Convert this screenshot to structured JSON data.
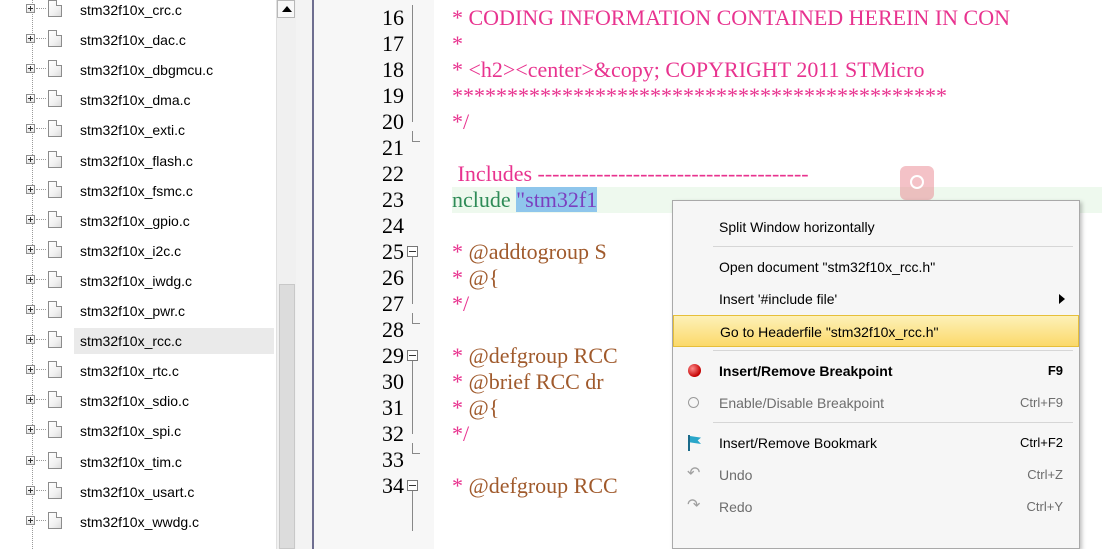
{
  "tree": {
    "selected_index": 11,
    "files": [
      "stm32f10x_crc.c",
      "stm32f10x_dac.c",
      "stm32f10x_dbgmcu.c",
      "stm32f10x_dma.c",
      "stm32f10x_exti.c",
      "stm32f10x_flash.c",
      "stm32f10x_fsmc.c",
      "stm32f10x_gpio.c",
      "stm32f10x_i2c.c",
      "stm32f10x_iwdg.c",
      "stm32f10x_pwr.c",
      "stm32f10x_rcc.c",
      "stm32f10x_rtc.c",
      "stm32f10x_sdio.c",
      "stm32f10x_spi.c",
      "stm32f10x_tim.c",
      "stm32f10x_usart.c",
      "stm32f10x_wwdg.c"
    ]
  },
  "editor": {
    "lines": [
      {
        "num": "16",
        "text": "* CODING INFORMATION CONTAINED HEREIN IN CON",
        "style": "comment"
      },
      {
        "num": "17",
        "text": "*",
        "style": "comment"
      },
      {
        "num": "18",
        "text": "* <h2><center>&copy; COPYRIGHT 2011 STMicro",
        "style": "comment"
      },
      {
        "num": "19",
        "text": "*********************************************",
        "style": "comment"
      },
      {
        "num": "20",
        "text": "*/",
        "style": "comment"
      },
      {
        "num": "21",
        "text": "",
        "style": "plain"
      },
      {
        "num": "22",
        "text": " Includes -------------------------------------",
        "style": "comment"
      },
      {
        "num": "23",
        "text_pre": "nclude ",
        "text_str": "\"stm32f1",
        "style": "include"
      },
      {
        "num": "24",
        "text": "",
        "style": "plain"
      },
      {
        "num": "25",
        "text_a": "* ",
        "text_b": "@addtogroup S",
        "style": "kwcomment",
        "fold": true
      },
      {
        "num": "26",
        "text_a": "* ",
        "text_b": "@{",
        "style": "kwcomment"
      },
      {
        "num": "27",
        "text": "*/",
        "style": "comment"
      },
      {
        "num": "28",
        "text": "",
        "style": "plain"
      },
      {
        "num": "29",
        "text_a": "* ",
        "text_b": "@defgroup RCC",
        "style": "kwcomment",
        "fold": true
      },
      {
        "num": "30",
        "text_a": "* ",
        "text_b": "@brief RCC dr",
        "style": "kwcomment"
      },
      {
        "num": "31",
        "text_a": "* ",
        "text_b": "@{",
        "style": "kwcomment"
      },
      {
        "num": "32",
        "text": "*/",
        "style": "comment"
      },
      {
        "num": "33",
        "text": "",
        "style": "plain"
      },
      {
        "num": "34",
        "text_a": "* ",
        "text_b": "@defgroup RCC",
        "style": "kwcomment",
        "fold": true
      }
    ]
  },
  "menu": {
    "items": [
      {
        "label": "Split Window horizontally",
        "shortcut": "",
        "icon": "",
        "type": "item"
      },
      {
        "type": "sep"
      },
      {
        "label": "Open document \"stm32f10x_rcc.h\"",
        "shortcut": "",
        "icon": "",
        "type": "item"
      },
      {
        "label": "Insert '#include file'",
        "shortcut": "",
        "icon": "submenu-arrow-icon",
        "type": "submenu"
      },
      {
        "label": "Go to Headerfile \"stm32f10x_rcc.h\"",
        "shortcut": "",
        "icon": "",
        "type": "item",
        "highlight": true
      },
      {
        "type": "sep"
      },
      {
        "label": "Insert/Remove Breakpoint",
        "shortcut": "F9",
        "icon": "breakpoint-icon",
        "type": "item",
        "bold": true
      },
      {
        "label": "Enable/Disable Breakpoint",
        "shortcut": "Ctrl+F9",
        "icon": "breakpoint-outline-icon",
        "type": "item",
        "disabled": true
      },
      {
        "type": "sep"
      },
      {
        "label": "Insert/Remove Bookmark",
        "shortcut": "Ctrl+F2",
        "icon": "bookmark-flag-icon",
        "type": "item"
      },
      {
        "label": "Undo",
        "shortcut": "Ctrl+Z",
        "icon": "undo-icon",
        "type": "item",
        "disabled": true
      },
      {
        "label": "Redo",
        "shortcut": "Ctrl+Y",
        "icon": "redo-icon",
        "type": "item",
        "disabled": true
      }
    ]
  }
}
